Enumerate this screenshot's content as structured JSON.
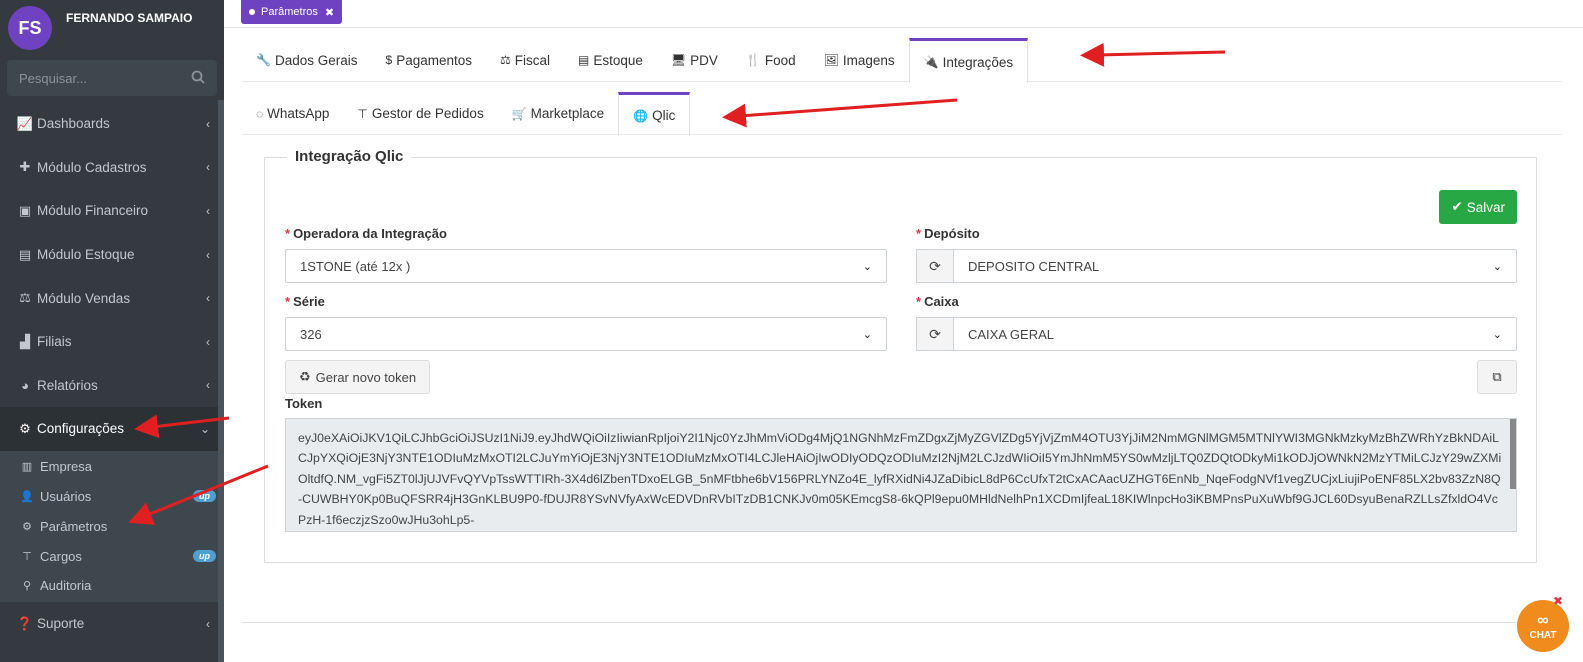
{
  "user": {
    "initials": "FS",
    "name": "FERNANDO SAMPAIO"
  },
  "search": {
    "placeholder": "Pesquisar..."
  },
  "menu": [
    {
      "icon": "area-chart-icon",
      "label": "Dashboards"
    },
    {
      "icon": "plus-icon",
      "label": "Módulo Cadastros"
    },
    {
      "icon": "money-icon",
      "label": "Módulo Financeiro"
    },
    {
      "icon": "archive-icon",
      "label": "Módulo Estoque"
    },
    {
      "icon": "balance-icon",
      "label": "Módulo Vendas"
    },
    {
      "icon": "industry-icon",
      "label": "Filiais"
    },
    {
      "icon": "pie-chart-icon",
      "label": "Relatórios"
    },
    {
      "icon": "gears-icon",
      "label": "Configurações"
    }
  ],
  "submenu": [
    {
      "icon": "building-icon",
      "label": "Empresa",
      "badge": ""
    },
    {
      "icon": "user-icon",
      "label": "Usuários",
      "badge": "up"
    },
    {
      "icon": "gear-icon",
      "label": "Parâmetros",
      "badge": ""
    },
    {
      "icon": "sitemap-icon",
      "label": "Cargos",
      "badge": "up"
    },
    {
      "icon": "archive-icon",
      "label": "Auditoria",
      "badge": ""
    }
  ],
  "support": {
    "icon": "question-circle-icon",
    "label": "Suporte"
  },
  "chip": {
    "label": "Parâmetros"
  },
  "tabs": [
    {
      "icon": "wrench-icon",
      "label": "Dados Gerais"
    },
    {
      "icon": "dollar-icon",
      "label": "Pagamentos"
    },
    {
      "icon": "balance-icon",
      "label": "Fiscal"
    },
    {
      "icon": "archive-icon",
      "label": "Estoque"
    },
    {
      "icon": "desktop-icon",
      "label": "PDV"
    },
    {
      "icon": "cutlery-icon",
      "label": "Food"
    },
    {
      "icon": "image-icon",
      "label": "Imagens"
    },
    {
      "icon": "plug-icon",
      "label": "Integrações"
    }
  ],
  "subtabs": [
    {
      "icon": "whatsapp-icon",
      "label": "WhatsApp"
    },
    {
      "icon": "sitemap-icon",
      "label": "Gestor de Pedidos"
    },
    {
      "icon": "cart-icon",
      "label": "Marketplace"
    },
    {
      "icon": "globe-icon",
      "label": "Qlic"
    }
  ],
  "form": {
    "legend": "Integração Qlic",
    "save_label": "Salvar",
    "operadora_label": "Operadora da Integração",
    "operadora_value": "1STONE (até 12x )",
    "deposito_label": "Depósito",
    "deposito_value": "DEPOSITO CENTRAL",
    "serie_label": "Série",
    "serie_value": "326",
    "caixa_label": "Caixa",
    "caixa_value": "CAIXA GERAL",
    "token_button": "Gerar novo token",
    "token_label": "Token",
    "token_value": "eyJ0eXAiOiJKV1QiLCJhbGciOiJSUzI1NiJ9.eyJhdWQiOiIzIiwianRpIjoiY2I1Njc0YzJhMmViODg4MjQ1NGNhMzFmZDgxZjMyZGVlZDg5YjVjZmM4OTU3YjJiM2NmMGNlMGM5MTNlYWI3MGNkMzkyMzBhZWRhYzBkNDAiLCJpYXQiOjE3NjY3NTE1ODIuMzMxOTI2LCJuYmYiOjE3NjY3NTE1ODIuMzMxOTI4LCJleHAiOjIwODIyODQzODIuMzI2NjM2LCJzdWIiOiI5YmJhNmM5YS0wMzljLTQ0ZDQtODkyMi1kODJjOWNkN2MzYTMiLCJzY29wZXMiOltdfQ.NM_vgFi5ZT0lJjUJVFvQYVpTssWTTIRh-3X4d6lZbenTDxoELGB_5nMFtbhe6bV156PRLYNZo4E_lyfRXidNi4JZaDibicL8dP6CcUfxT2tCxACAacUZHGT6EnNb_NqeFodgNVf1vegZUCjxLiujiPoENF85LX2bv83ZzN8Q-CUWBHY0Kp0BuQFSRR4jH3GnKLBU9P0-fDUJR8YSvNVfyAxWcEDVDnRVbITzDB1CNKJv0m05KEmcgS8-6kQPl9epu0MHldNelhPn1XCDmIjfeaL18KIWlnpcHo3iKBMPnsPuXuWbf9GJCL60DsyuBenaRZLLsZfxldO4VcPzH-1f6eczjzSzo0wJHu3ohLp5-"
  },
  "chat": {
    "label": "CHAT"
  }
}
